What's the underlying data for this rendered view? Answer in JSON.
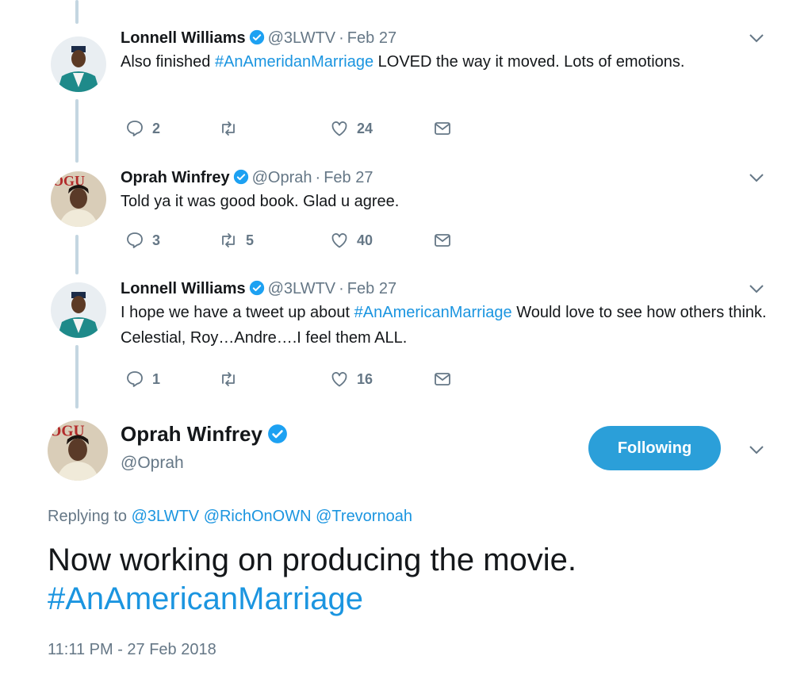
{
  "thread": [
    {
      "name": "Lonnell Williams",
      "handle": "@3LWTV",
      "dot": "·",
      "date": "Feb 27",
      "text_before": "Also finished ",
      "hashtag": "#AnAmeridanMarriage",
      "text_after": " LOVED the way it moved.  Lots of emotions.",
      "replies": "2",
      "retweets": "",
      "likes": "24",
      "avatar": "lonnell-avatar"
    },
    {
      "name": "Oprah Winfrey",
      "handle": "@Oprah",
      "dot": "·",
      "date": "Feb 27",
      "text_before": "Told ya it was good book. Glad u agree.",
      "hashtag": "",
      "text_after": "",
      "replies": "3",
      "retweets": "5",
      "likes": "40",
      "avatar": "oprah-avatar"
    },
    {
      "name": "Lonnell Williams",
      "handle": "@3LWTV",
      "dot": "·",
      "date": "Feb 27",
      "text_before": "I hope we have a tweet up about ",
      "hashtag": "#AnAmericanMarriage",
      "text_after": " Would love to see how others think.  Celestial, Roy…Andre….I feel them ALL.",
      "replies": "1",
      "retweets": "",
      "likes": "16",
      "avatar": "lonnell-avatar"
    }
  ],
  "main_tweet": {
    "name": "Oprah Winfrey",
    "handle": "@Oprah",
    "follow_label": "Following",
    "replying_label": "Replying to",
    "mentions": [
      "@3LWTV",
      "@RichOnOWN",
      "@Trevornoah"
    ],
    "text": "Now working on producing the movie.",
    "hashtag": "#AnAmericanMarriage",
    "timestamp": "11:11 PM - 27 Feb 2018"
  },
  "colors": {
    "link": "#1b95e0",
    "secondary_text": "#657786",
    "follow_button": "#2b9fd9",
    "thread_line": "#c4d6e1",
    "verified": "#1da1f2"
  },
  "icons": [
    "reply-icon",
    "retweet-icon",
    "like-icon",
    "direct-message-icon",
    "verified-badge-icon",
    "chevron-down-icon"
  ]
}
